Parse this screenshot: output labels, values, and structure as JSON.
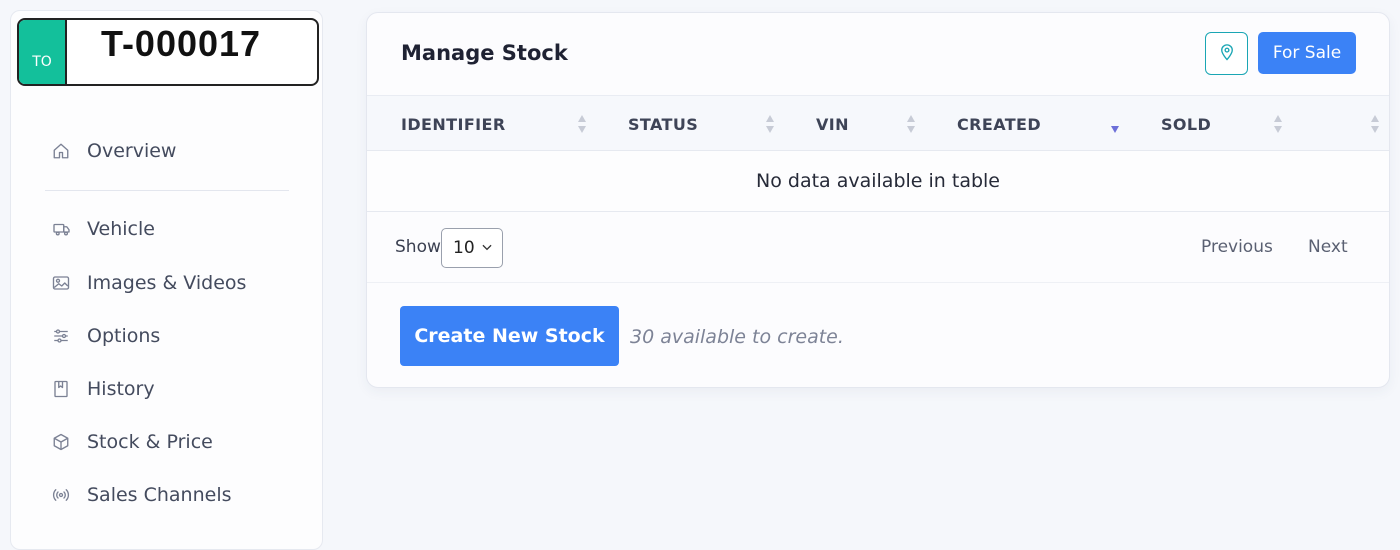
{
  "plate": {
    "badge": "TO",
    "number": "T-000017"
  },
  "sidebar": {
    "items": [
      {
        "label": "Overview",
        "icon": "home-icon"
      },
      {
        "label": "Vehicle",
        "icon": "truck-icon"
      },
      {
        "label": "Images & Videos",
        "icon": "image-icon"
      },
      {
        "label": "Options",
        "icon": "sliders-icon"
      },
      {
        "label": "History",
        "icon": "book-icon"
      },
      {
        "label": "Stock & Price",
        "icon": "box-icon"
      },
      {
        "label": "Sales Channels",
        "icon": "broadcast-icon"
      }
    ]
  },
  "card": {
    "title": "Manage Stock",
    "for_sale_label": "For Sale",
    "location_icon": "map-pin-icon"
  },
  "table": {
    "columns": [
      "IDENTIFIER",
      "STATUS",
      "VIN",
      "CREATED",
      "SOLD",
      ""
    ],
    "sorted_column": "CREATED",
    "sort_direction": "descending",
    "empty_message": "No data available in table"
  },
  "pagination": {
    "show_label": "Show",
    "page_size": "10",
    "previous_label": "Previous",
    "next_label": "Next"
  },
  "actions": {
    "create_label": "Create New Stock",
    "available_text": "30 available to create."
  },
  "colors": {
    "primary": "#3b82f6",
    "plate_green": "#13c09b",
    "teal_outline": "#1aa6b4",
    "sort_active": "#6c6fd8"
  }
}
